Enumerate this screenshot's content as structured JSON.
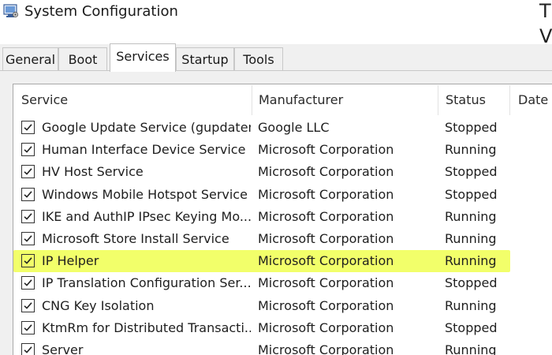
{
  "window": {
    "title": "System Configuration"
  },
  "background_text": [
    "T",
    "V"
  ],
  "tabs": [
    {
      "label": "General",
      "active": false
    },
    {
      "label": "Boot",
      "active": false
    },
    {
      "label": "Services",
      "active": true
    },
    {
      "label": "Startup",
      "active": false
    },
    {
      "label": "Tools",
      "active": false
    }
  ],
  "columns": {
    "service": "Service",
    "manufacturer": "Manufacturer",
    "status": "Status",
    "date": "Date I"
  },
  "services": [
    {
      "name": "Google Update Service (gupdatem)",
      "manufacturer": "Google LLC",
      "status": "Stopped",
      "checked": true,
      "highlighted": false
    },
    {
      "name": "Human Interface Device Service",
      "manufacturer": "Microsoft Corporation",
      "status": "Running",
      "checked": true,
      "highlighted": false
    },
    {
      "name": "HV Host Service",
      "manufacturer": "Microsoft Corporation",
      "status": "Stopped",
      "checked": true,
      "highlighted": false
    },
    {
      "name": "Windows Mobile Hotspot Service",
      "manufacturer": "Microsoft Corporation",
      "status": "Stopped",
      "checked": true,
      "highlighted": false
    },
    {
      "name": "IKE and AuthIP IPsec Keying Mo...",
      "manufacturer": "Microsoft Corporation",
      "status": "Running",
      "checked": true,
      "highlighted": false
    },
    {
      "name": "Microsoft Store Install Service",
      "manufacturer": "Microsoft Corporation",
      "status": "Running",
      "checked": true,
      "highlighted": false
    },
    {
      "name": "IP Helper",
      "manufacturer": "Microsoft Corporation",
      "status": "Running",
      "checked": true,
      "highlighted": true
    },
    {
      "name": "IP Translation Configuration Ser...",
      "manufacturer": "Microsoft Corporation",
      "status": "Stopped",
      "checked": true,
      "highlighted": false
    },
    {
      "name": "CNG Key Isolation",
      "manufacturer": "Microsoft Corporation",
      "status": "Running",
      "checked": true,
      "highlighted": false
    },
    {
      "name": "KtmRm for Distributed Transacti...",
      "manufacturer": "Microsoft Corporation",
      "status": "Stopped",
      "checked": true,
      "highlighted": false
    },
    {
      "name": "Server",
      "manufacturer": "Microsoft Corporation",
      "status": "Running",
      "checked": true,
      "highlighted": false
    }
  ],
  "colors": {
    "highlight": "#f2ff6a",
    "tab_strip": "#f0f0f0"
  }
}
